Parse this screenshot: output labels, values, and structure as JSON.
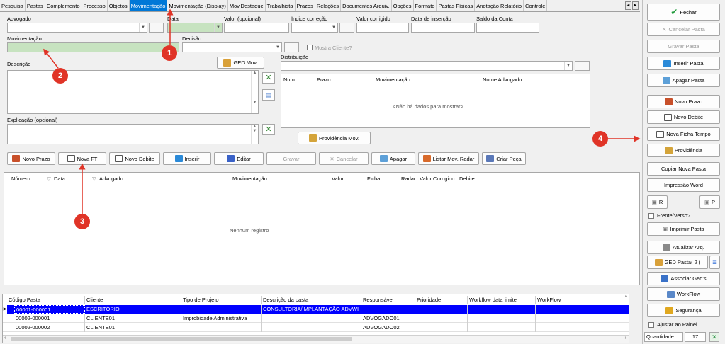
{
  "tabs": {
    "items": [
      "Pesquisa",
      "Pastas",
      "Complemento",
      "Processo",
      "Objetos",
      "Movimentação",
      "Movimentação (Display)",
      "Mov.Destaque",
      "Trabalhista",
      "Prazos",
      "Relações",
      "Documentos Arquiv.",
      "Opções",
      "Formato",
      "Pastas Físicas",
      "Anotação Relatório",
      "Controle"
    ],
    "active": "Movimentação",
    "nav_left": "◄",
    "nav_right": "►"
  },
  "form": {
    "advogado_label": "Advogado",
    "data_label": "Data",
    "valor_label": "Valor (opcional)",
    "indice_label": "Índice correção",
    "valor_corrigido_label": "Valor corrigido",
    "data_insercao_label": "Data de inserção",
    "saldo_label": "Saldo da Conta",
    "movimentacao_label": "Movimentação",
    "decisao_label": "Decisão",
    "mostra_cliente_label": "Mostra Cliente?",
    "descricao_label": "Descrição",
    "ged_mov_label": "GED Mov.",
    "distribuicao_label": "Distribuição",
    "explicacao_label": "Explicação (opcional)",
    "providencia_mov_label": "Providência Mov."
  },
  "distribution_table": {
    "columns": [
      "Num",
      "Prazo",
      "Movimentação",
      "Nome Advogado"
    ],
    "empty": "<Não há dados para mostrar>"
  },
  "toolbar": {
    "novo_prazo": "Novo Prazo",
    "nova_ft": "Nova FT",
    "novo_debite": "Novo Debite",
    "inserir": "Inserir",
    "editar": "Editar",
    "gravar": "Gravar",
    "cancelar": "Cancelar",
    "apagar": "Apagar",
    "listar_mov_radar": "Listar Mov. Radar",
    "criar_peca": "Criar Peça"
  },
  "mov_list": {
    "columns": [
      "Número",
      "Data",
      "Advogado",
      "Movimentação",
      "Valor",
      "Ficha",
      "Radar",
      "Valor Corrigido",
      "Debite"
    ],
    "empty": "Nenhum registro"
  },
  "bottom_grid": {
    "columns": [
      "Código Pasta",
      "Cliente",
      "Tipo de Projeto",
      "Descrição da pasta",
      "Responsável",
      "Prioridade",
      "Workflow data limite",
      "WorkFlow"
    ],
    "rows": [
      [
        "00001-000001",
        "ESCRITÓRIO",
        "",
        "CONSULTORIA/IMPLANTAÇÃO ADVWI",
        "",
        "",
        "",
        ""
      ],
      [
        "00002-000001",
        "CLIENTE01",
        "Improbidade Administrativa",
        "",
        "ADVOGADO01",
        "",
        "",
        ""
      ],
      [
        "00002-000002",
        "CLIENTE01",
        "",
        "",
        "ADVOGADO02",
        "",
        "",
        ""
      ]
    ]
  },
  "side": {
    "fechar": "Fechar",
    "cancelar_pasta": "Cancelar Pasta",
    "gravar_pasta": "Gravar Pasta",
    "inserir_pasta": "Inserir Pasta",
    "apagar_pasta": "Apagar Pasta",
    "novo_prazo": "Novo Prazo",
    "novo_debite": "Novo Debite",
    "nova_ficha_tempo": "Nova Ficha Tempo",
    "providencia": "Providência",
    "copiar_nova_pasta": "Copiar Nova Pasta",
    "impressao_word": "Impressão Word",
    "r_label": "R",
    "p_label": "P",
    "frente_verso": "Frente/Verso?",
    "imprimir_pasta": "Imprimir Pasta",
    "atualizar_arq": "Atualizar Arq.",
    "ged_pasta": "GED Pasta( 2 )",
    "associar_geds": "Associar Ged's",
    "workflow": "WorkFlow",
    "seguranca": "Segurança",
    "ajustar_painel": "Ajustar ao Painel",
    "quantidade_label": "Quantidade",
    "quantidade_value": "17"
  },
  "callouts": [
    "1",
    "2",
    "3",
    "4"
  ],
  "colors": {
    "accent": "#0078d7",
    "selection": "#0000ff",
    "callout": "#e03427",
    "highlight_field": "#c7e3c0"
  }
}
